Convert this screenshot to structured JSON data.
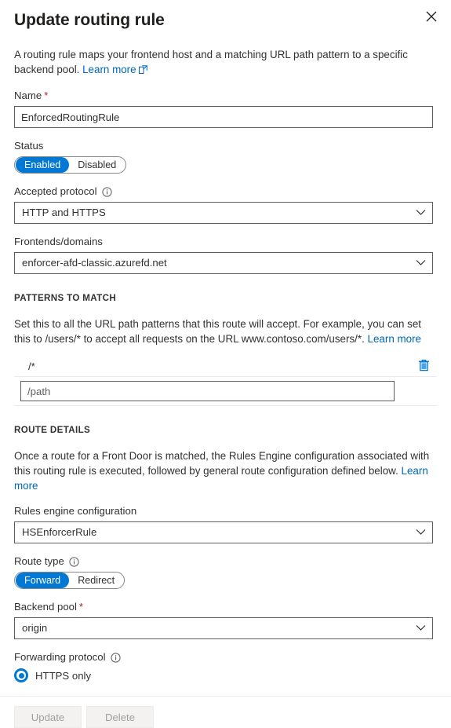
{
  "header": {
    "title": "Update routing rule",
    "close_icon": "close-icon"
  },
  "intro": {
    "text": "A routing rule maps your frontend host and a matching URL path pattern to a specific backend pool. ",
    "link_label": "Learn more",
    "link_icon": "external-link-icon"
  },
  "name_field": {
    "label": "Name",
    "required_marker": "*",
    "value": "EnforcedRoutingRule"
  },
  "status_field": {
    "label": "Status",
    "options": [
      "Enabled",
      "Disabled"
    ],
    "selected": "Enabled"
  },
  "accepted_protocol": {
    "label": "Accepted protocol",
    "info_icon": "info-icon",
    "value": "HTTP and HTTPS",
    "chevron_icon": "chevron-down-icon"
  },
  "frontends": {
    "label": "Frontends/domains",
    "value": "enforcer-afd-classic.azurefd.net",
    "chevron_icon": "chevron-down-icon"
  },
  "patterns_section": {
    "heading": "PATTERNS TO MATCH",
    "description": "Set this to all the URL path patterns that this route will accept. For example, you can set this to /users/* to accept all requests on the URL www.contoso.com/users/*. ",
    "link_label": "Learn more",
    "rows": [
      {
        "value": "/*",
        "delete_icon": "trash-icon"
      }
    ],
    "new_row_placeholder": "/path",
    "new_row_value": ""
  },
  "route_details": {
    "heading": "ROUTE DETAILS",
    "description": "Once a route for a Front Door is matched, the Rules Engine configuration associated with this routing rule is executed, followed by general route configuration defined below. ",
    "link_label": "Learn more"
  },
  "rules_engine": {
    "label": "Rules engine configuration",
    "value": "HSEnforcerRule",
    "chevron_icon": "chevron-down-icon"
  },
  "route_type": {
    "label": "Route type",
    "info_icon": "info-icon",
    "options": [
      "Forward",
      "Redirect"
    ],
    "selected": "Forward"
  },
  "backend_pool": {
    "label": "Backend pool",
    "required_marker": "*",
    "value": "origin",
    "chevron_icon": "chevron-down-icon"
  },
  "forwarding_protocol": {
    "label": "Forwarding protocol",
    "info_icon": "info-icon",
    "option_label": "HTTPS only",
    "selected": true
  },
  "footer": {
    "update_label": "Update",
    "delete_label": "Delete",
    "update_disabled": true,
    "delete_disabled": true
  },
  "colors": {
    "accent": "#0078d4",
    "link": "#0067b8",
    "required": "#a4262c",
    "text": "#323130",
    "border": "#605e5c",
    "divider": "#edebe9"
  }
}
